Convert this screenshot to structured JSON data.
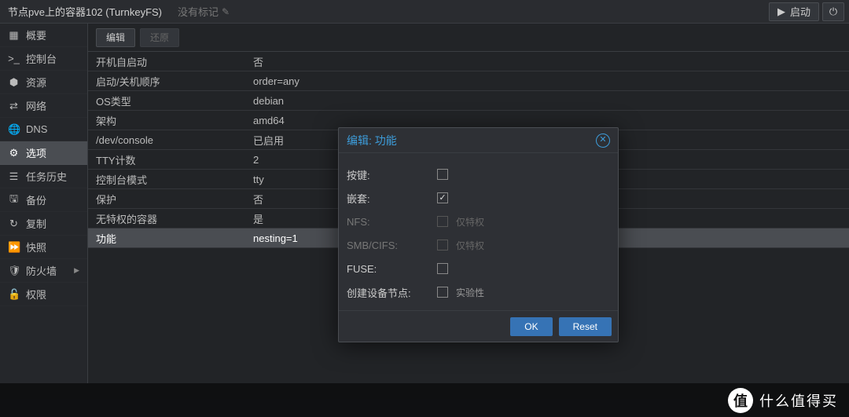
{
  "header": {
    "title": "节点pve上的容器102 (TurnkeyFS)",
    "tags_label": "没有标记",
    "start_label": "启动"
  },
  "sidebar": {
    "items": [
      {
        "icon": "▦",
        "label": "概要"
      },
      {
        "icon": ">_",
        "label": "控制台"
      },
      {
        "icon": "⬢",
        "label": "资源"
      },
      {
        "icon": "⇄",
        "label": "网络"
      },
      {
        "icon": "🌐",
        "label": "DNS"
      },
      {
        "icon": "⚙",
        "label": "选项"
      },
      {
        "icon": "☰",
        "label": "任务历史"
      },
      {
        "icon": "🖫",
        "label": "备份"
      },
      {
        "icon": "↻",
        "label": "复制"
      },
      {
        "icon": "⏩",
        "label": "快照"
      },
      {
        "icon": "🛡",
        "label": "防火墙"
      },
      {
        "icon": "🔓",
        "label": "权限"
      }
    ],
    "active_index": 5,
    "submenu_index": 10
  },
  "toolbar": {
    "edit_label": "编辑",
    "revert_label": "还原"
  },
  "table": {
    "rows": [
      {
        "key": "开机自启动",
        "value": "否"
      },
      {
        "key": "启动/关机顺序",
        "value": "order=any"
      },
      {
        "key": "OS类型",
        "value": "debian"
      },
      {
        "key": "架构",
        "value": "amd64"
      },
      {
        "key": "/dev/console",
        "value": "已启用"
      },
      {
        "key": "TTY计数",
        "value": "2"
      },
      {
        "key": "控制台模式",
        "value": "tty"
      },
      {
        "key": "保护",
        "value": "否"
      },
      {
        "key": "无特权的容器",
        "value": "是"
      },
      {
        "key": "功能",
        "value": "nesting=1"
      }
    ],
    "selected_index": 9
  },
  "modal": {
    "title": "编辑: 功能",
    "fields": [
      {
        "label": "按键:",
        "checked": false,
        "note": "",
        "disabled": false
      },
      {
        "label": "嵌套:",
        "checked": true,
        "note": "",
        "disabled": false
      },
      {
        "label": "NFS:",
        "checked": false,
        "note": "仅特权",
        "disabled": true
      },
      {
        "label": "SMB/CIFS:",
        "checked": false,
        "note": "仅特权",
        "disabled": true
      },
      {
        "label": "FUSE:",
        "checked": false,
        "note": "",
        "disabled": false
      },
      {
        "label": "创建设备节点:",
        "checked": false,
        "note": "实验性",
        "disabled": false
      }
    ],
    "ok_label": "OK",
    "reset_label": "Reset"
  },
  "brand": {
    "glyph": "值",
    "text": "什么值得买"
  }
}
